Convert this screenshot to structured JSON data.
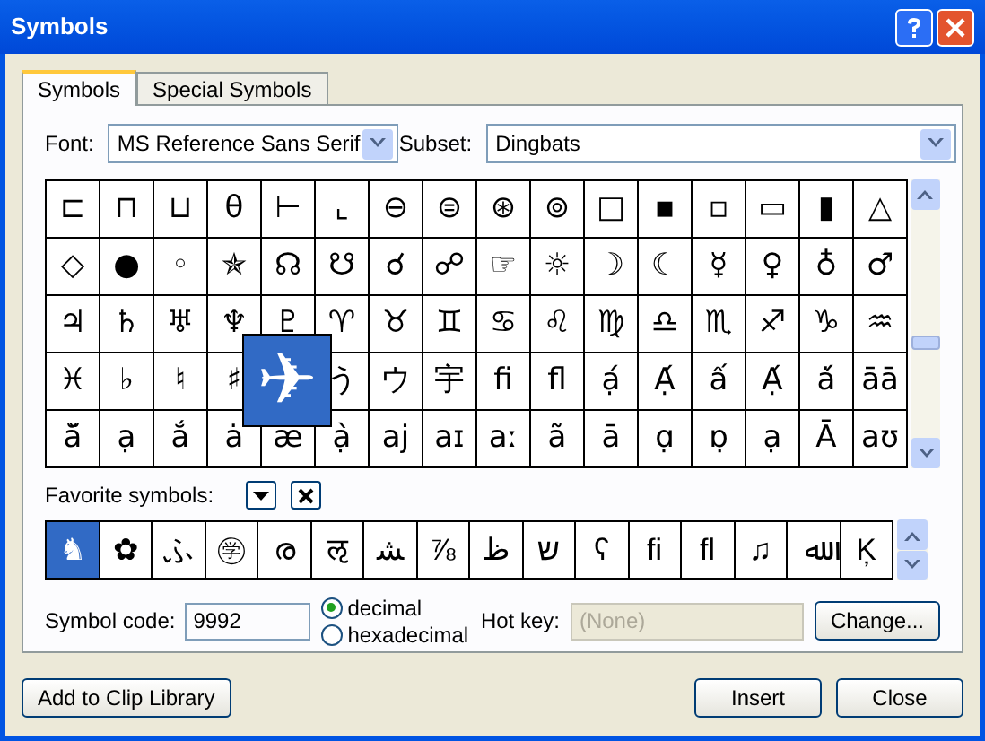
{
  "window": {
    "title": "Symbols"
  },
  "tabs": [
    {
      "label": "Symbols",
      "selected": true
    },
    {
      "label": "Special Symbols",
      "selected": false
    }
  ],
  "font": {
    "label": "Font:",
    "value": "MS Reference Sans Serif"
  },
  "subset": {
    "label": "Subset:",
    "value": "Dingbats"
  },
  "grid": [
    [
      "⊏",
      "⊓",
      "⊔",
      "θ",
      "⊢",
      "⌞",
      "⊖",
      "⊜",
      "⊛",
      "⊚",
      "□",
      "▪",
      "▫",
      "▭",
      "▮",
      "△"
    ],
    [
      "◇",
      "●",
      "◦",
      "✯",
      "☊",
      "☋",
      "☌",
      "☍",
      "☞",
      "☼",
      "☽",
      "☾",
      "☿",
      "♀",
      "♁",
      "♂"
    ],
    [
      "♃",
      "♄",
      "♅",
      "♆",
      "♇",
      "♈",
      "♉",
      "♊",
      "♋",
      "♌",
      "♍",
      "♎",
      "♏",
      "♐",
      "♑",
      "♒"
    ],
    [
      "♓",
      "♭",
      "♮",
      "♯",
      {
        "symbol": "✈",
        "selected": true
      },
      "う",
      "ウ",
      "宇",
      "ﬁ",
      "ﬂ",
      "ạ́",
      "Ạ́",
      "ấ",
      "Ạ́",
      "ȧ́",
      "āā"
    ],
    [
      "ă̆",
      "ạ",
      "ắ",
      "ȧ",
      "æ",
      "ạ̀",
      "aj",
      "aɪ",
      "aː",
      "ã",
      "ā",
      "ɑ̣",
      "ɒ̣",
      "ạ",
      "Ā",
      "aʊ"
    ]
  ],
  "favorites": {
    "label": "Favorite symbols:",
    "items": [
      {
        "symbol": "♞",
        "selected": true
      },
      {
        "symbol": "✿",
        "selected": false
      },
      {
        "symbol": "ふ",
        "selected": false
      },
      {
        "symbol": "㊫",
        "selected": false
      },
      {
        "symbol": "ര",
        "selected": false
      },
      {
        "symbol": "ऌ",
        "selected": false
      },
      {
        "symbol": "ﺸ",
        "selected": false
      },
      {
        "symbol": "⅞",
        "selected": false
      },
      {
        "symbol": "ظ",
        "selected": false
      },
      {
        "symbol": "ש",
        "selected": false
      },
      {
        "symbol": "ʕ",
        "selected": false
      },
      {
        "symbol": "ﬁ",
        "selected": false
      },
      {
        "symbol": "ﬂ",
        "selected": false
      },
      {
        "symbol": "♫",
        "selected": false
      },
      {
        "symbol": "ﷲ",
        "selected": false
      },
      {
        "symbol": "Ķ",
        "selected": false
      }
    ]
  },
  "symbol_code": {
    "label": "Symbol code:",
    "value": "9992"
  },
  "radios": [
    {
      "label": "decimal",
      "selected": true
    },
    {
      "label": "hexadecimal",
      "selected": false
    }
  ],
  "hot_key": {
    "label": "Hot key:",
    "placeholder": "(None)",
    "disabled": true
  },
  "buttons": {
    "change": "Change...",
    "add": "Add to Clip Library",
    "insert": "Insert",
    "close": "Close"
  }
}
